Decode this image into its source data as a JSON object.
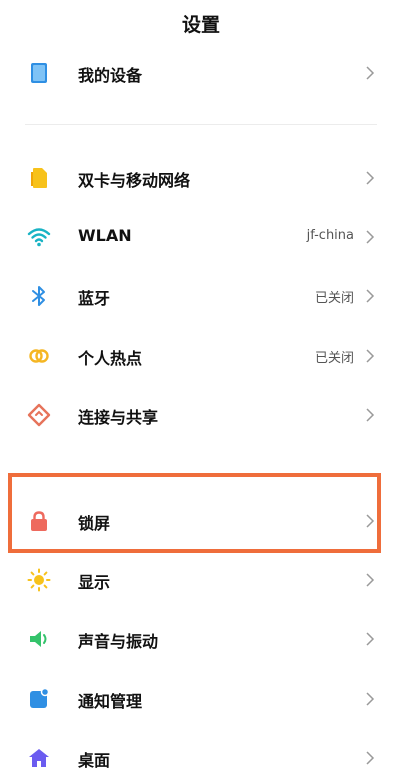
{
  "header": {
    "title": "设置"
  },
  "colors": {
    "highlight": "#ef6d3b"
  },
  "items": [
    {
      "label": "我的设备",
      "value": "",
      "icon": "device-icon"
    },
    {
      "label": "双卡与移动网络",
      "value": "",
      "icon": "sim-card-icon"
    },
    {
      "label": "WLAN",
      "value": "jf-china",
      "icon": "wifi-icon"
    },
    {
      "label": "蓝牙",
      "value": "已关闭",
      "icon": "bluetooth-icon"
    },
    {
      "label": "个人热点",
      "value": "已关闭",
      "icon": "hotspot-icon"
    },
    {
      "label": "连接与共享",
      "value": "",
      "icon": "connection-share-icon"
    },
    {
      "label": "锁屏",
      "value": "",
      "icon": "lock-icon"
    },
    {
      "label": "显示",
      "value": "",
      "icon": "display-sun-icon"
    },
    {
      "label": "声音与振动",
      "value": "",
      "icon": "sound-icon"
    },
    {
      "label": "通知管理",
      "value": "",
      "icon": "notification-icon"
    },
    {
      "label": "桌面",
      "value": "",
      "icon": "home-icon"
    }
  ]
}
